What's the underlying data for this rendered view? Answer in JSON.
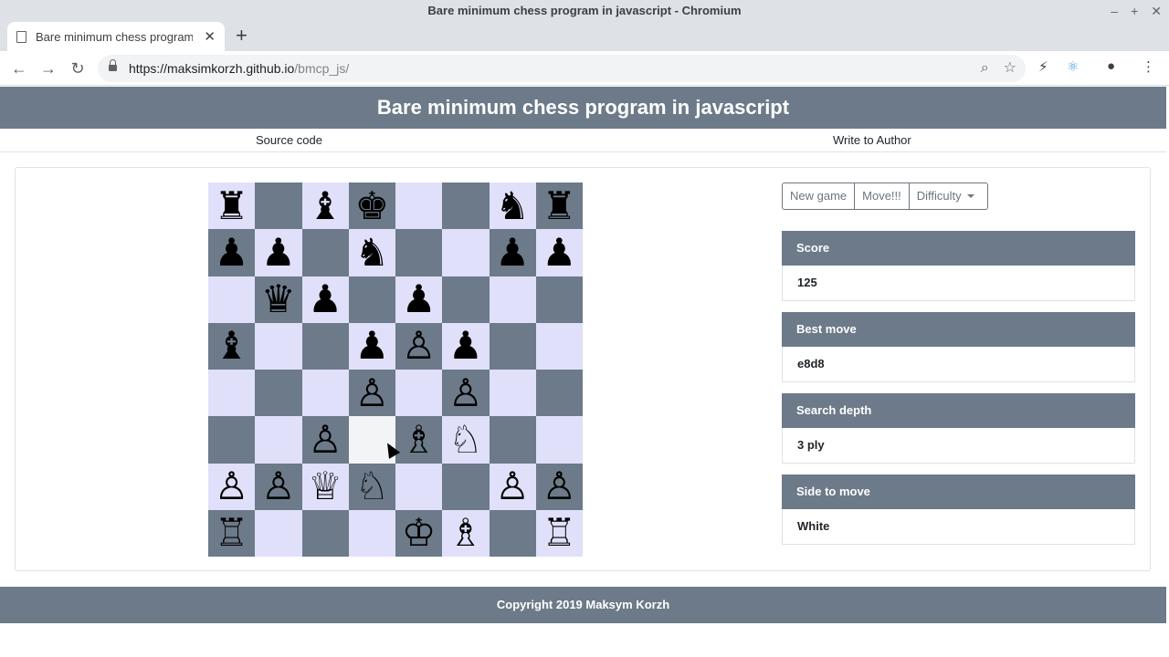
{
  "window": {
    "title": "Bare minimum chess program in javascript - Chromium"
  },
  "tab": {
    "title": "Bare minimum chess program in javascript"
  },
  "address": {
    "host": "https://maksimkorzh.github.io",
    "path": "/bmcp_js/"
  },
  "page": {
    "title": "Bare minimum chess program in javascript",
    "links": {
      "source": "Source code",
      "author": "Write to Author"
    },
    "controls": {
      "new_game": "New game",
      "move": "Move!!!",
      "difficulty": "Difficulty"
    },
    "panels": [
      {
        "label": "Score",
        "value": "125"
      },
      {
        "label": "Best move",
        "value": "e8d8"
      },
      {
        "label": "Search depth",
        "value": "3 ply"
      },
      {
        "label": "Side to move",
        "value": "White"
      }
    ],
    "footer": "Copyright 2019 Maksym Korzh"
  },
  "board": {
    "ranks": [
      [
        "♜",
        "",
        "♝",
        "♚",
        "",
        "",
        "♞",
        "♜"
      ],
      [
        "♟",
        "♟",
        "",
        "♞",
        "",
        "",
        "♟",
        "♟"
      ],
      [
        "",
        "♛",
        "♟",
        "",
        "♟",
        "",
        "",
        ""
      ],
      [
        "♝",
        "",
        "",
        "♟",
        "♙",
        "♟",
        "",
        ""
      ],
      [
        "",
        "",
        "",
        "♙",
        "",
        "♙",
        "",
        ""
      ],
      [
        "",
        "",
        "♙",
        "",
        "♗",
        "♘",
        "",
        ""
      ],
      [
        "♙",
        "♙",
        "♕",
        "♘",
        "",
        "",
        "♙",
        "♙"
      ],
      [
        "♖",
        "",
        "",
        "",
        "♔",
        "♗",
        "",
        "♖"
      ]
    ],
    "highlight": "d3"
  }
}
